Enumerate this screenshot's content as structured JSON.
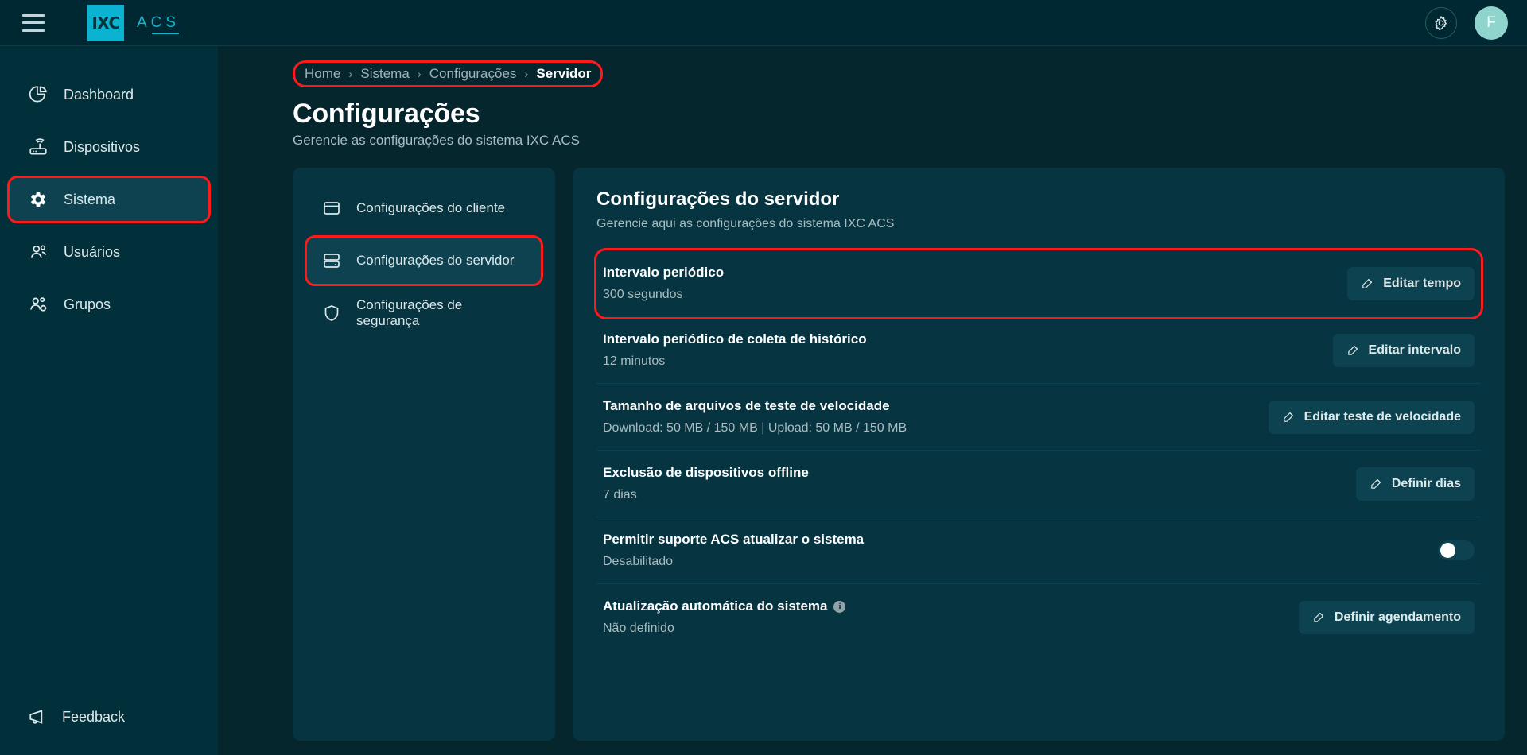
{
  "topbar": {
    "menu_icon": "hamburger-icon",
    "logo_mark": "IXC",
    "logo_text": "ACS",
    "gear_icon": "gear-icon",
    "avatar_initial": "F"
  },
  "sidebar": {
    "items": [
      {
        "label": "Dashboard",
        "icon": "pie-chart-icon",
        "active": false,
        "highlight": false
      },
      {
        "label": "Dispositivos",
        "icon": "router-icon",
        "active": false,
        "highlight": false
      },
      {
        "label": "Sistema",
        "icon": "gear-icon",
        "active": true,
        "highlight": true
      },
      {
        "label": "Usuários",
        "icon": "users-icon",
        "active": false,
        "highlight": false
      },
      {
        "label": "Grupos",
        "icon": "users-gear-icon",
        "active": false,
        "highlight": false
      }
    ],
    "feedback": {
      "label": "Feedback",
      "icon": "megaphone-icon"
    }
  },
  "breadcrumb": {
    "items": [
      "Home",
      "Sistema",
      "Configurações",
      "Servidor"
    ],
    "separator": "›",
    "highlight_color": "#ff1a1a"
  },
  "page": {
    "title": "Configurações",
    "subtitle": "Gerencie as configurações do sistema IXC ACS"
  },
  "categories": [
    {
      "label": "Configurações do cliente",
      "icon": "window-icon",
      "active": false,
      "highlight": false
    },
    {
      "label": "Configurações do servidor",
      "icon": "server-icon",
      "active": true,
      "highlight": true
    },
    {
      "label": "Configurações de segurança",
      "icon": "shield-icon",
      "active": false,
      "highlight": false
    }
  ],
  "panel": {
    "title": "Configurações do servidor",
    "subtitle": "Gerencie aqui as configurações do sistema IXC ACS",
    "rows": [
      {
        "label": "Intervalo periódico",
        "value": "300 segundos",
        "control": "button",
        "button_label": "Editar tempo",
        "button_icon": "edit-pencil-icon",
        "highlight": true,
        "info": false
      },
      {
        "label": "Intervalo periódico de coleta de histórico",
        "value": "12 minutos",
        "control": "button",
        "button_label": "Editar intervalo",
        "button_icon": "edit-pencil-icon",
        "highlight": false,
        "info": false
      },
      {
        "label": "Tamanho de arquivos de teste de velocidade",
        "value": "Download: 50 MB / 150 MB | Upload: 50 MB / 150 MB",
        "control": "button",
        "button_label": "Editar teste de velocidade",
        "button_icon": "edit-pencil-icon",
        "highlight": false,
        "info": false
      },
      {
        "label": "Exclusão de dispositivos offline",
        "value": "7 dias",
        "control": "button",
        "button_label": "Definir dias",
        "button_icon": "edit-pencil-icon",
        "highlight": false,
        "info": false
      },
      {
        "label": "Permitir suporte ACS atualizar o sistema",
        "value": "Desabilitado",
        "control": "toggle",
        "toggle_state": "off",
        "highlight": false,
        "info": false
      },
      {
        "label": "Atualização automática do sistema",
        "value": "Não definido",
        "control": "button",
        "button_label": "Definir agendamento",
        "button_icon": "edit-pencil-icon",
        "highlight": false,
        "info": true,
        "info_icon": "info-icon"
      }
    ]
  },
  "colors": {
    "page_bg": "#06262e",
    "topbar_bg": "#002832",
    "sidebar_bg": "#02303a",
    "card_bg": "#063440",
    "accent_cyan": "#0bb3d1",
    "highlight_red": "#ff1a1a",
    "active_row": "#0e4250",
    "avatar_bg": "#8fd4cd"
  }
}
